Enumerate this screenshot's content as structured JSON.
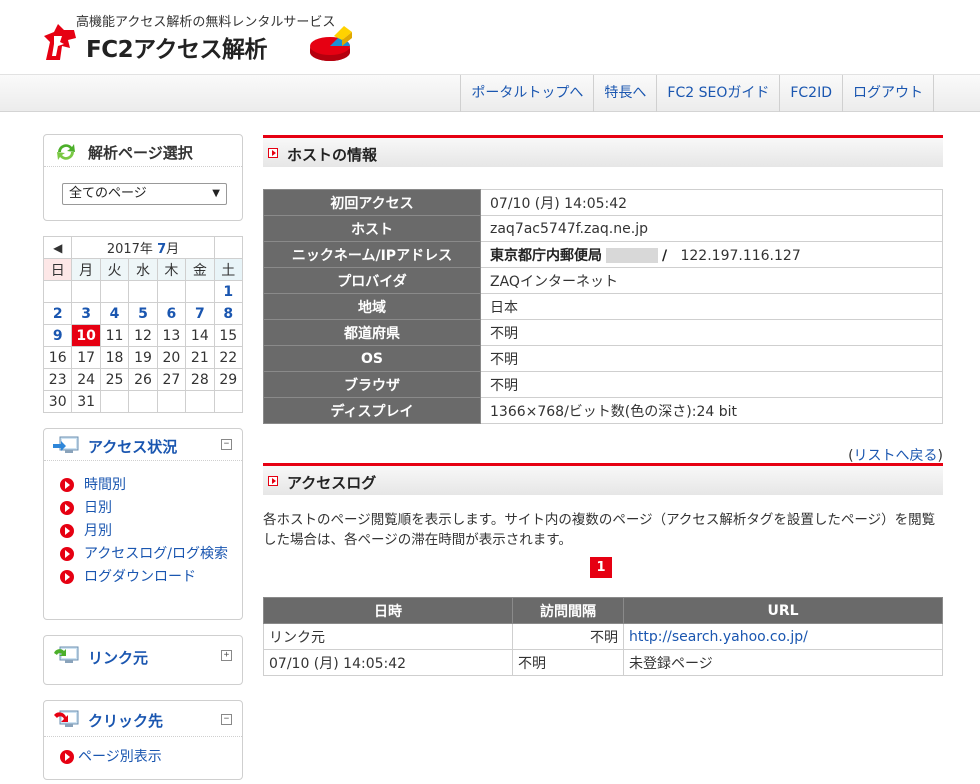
{
  "header": {
    "tagline": "高機能アクセス解析の無料レンタルサービス",
    "logo_text": "FC2アクセス解析"
  },
  "nav": [
    {
      "label": "ポータルトップへ"
    },
    {
      "label": "特長へ"
    },
    {
      "label": "FC2 SEOガイド"
    },
    {
      "label": "FC2ID"
    },
    {
      "label": "ログアウト"
    }
  ],
  "sidebar": {
    "page_select": {
      "title": "解析ページ選択",
      "selected": "全てのページ"
    },
    "calendar": {
      "prev": "◀",
      "year": "2017年",
      "month": "7",
      "month_suffix": "月",
      "weekdays": [
        "日",
        "月",
        "火",
        "水",
        "木",
        "金",
        "土"
      ],
      "weeks": [
        [
          "",
          "",
          "",
          "",
          "",
          "",
          "1"
        ],
        [
          "2",
          "3",
          "4",
          "5",
          "6",
          "7",
          "8"
        ],
        [
          "9",
          "10",
          "11",
          "12",
          "13",
          "14",
          "15"
        ],
        [
          "16",
          "17",
          "18",
          "19",
          "20",
          "21",
          "22"
        ],
        [
          "23",
          "24",
          "25",
          "26",
          "27",
          "28",
          "29"
        ],
        [
          "30",
          "31",
          "",
          "",
          "",
          "",
          ""
        ]
      ],
      "today": "10"
    },
    "access": {
      "title": "アクセス状況",
      "toggle": "−",
      "items": [
        {
          "label": "時間別"
        },
        {
          "label": "日別"
        },
        {
          "label": "月別"
        },
        {
          "label": "アクセスログ/ログ検索"
        },
        {
          "label": "ログダウンロード"
        }
      ]
    },
    "link": {
      "title": "リンク元",
      "toggle": "+"
    },
    "click": {
      "title": "クリック先",
      "toggle": "−",
      "items": [
        {
          "label": "ページ別表示"
        }
      ]
    }
  },
  "host": {
    "title": "ホストの情報",
    "rows": [
      {
        "label": "初回アクセス",
        "value": "07/10 (月) 14:05:42"
      },
      {
        "label": "ホスト",
        "value": "zaq7ac5747f.zaq.ne.jp"
      },
      {
        "label": "ニックネーム/IPアドレス",
        "nickname": "東京都庁内郵便局",
        "separator": "/",
        "ip": "122.197.116.127"
      },
      {
        "label": "プロバイダ",
        "value": "ZAQインターネット"
      },
      {
        "label": "地域",
        "value": "日本"
      },
      {
        "label": "都道府県",
        "value": "不明"
      },
      {
        "label": "OS",
        "value": "不明"
      },
      {
        "label": "ブラウザ",
        "value": "不明"
      },
      {
        "label": "ディスプレイ",
        "value": "1366×768/ビット数(色の深さ):24 bit"
      }
    ],
    "back_open": "(",
    "back_label": "リストへ戻る",
    "back_close": ")"
  },
  "log": {
    "title": "アクセスログ",
    "description": "各ホストのページ閲覧順を表示します。サイト内の複数のページ（アクセス解析タグを設置したページ）を閲覧した場合は、各ページの滞在時間が表示されます。",
    "page": "1",
    "columns": [
      "日時",
      "訪問間隔",
      "URL"
    ],
    "rows": [
      {
        "date": "リンク元",
        "interval": "不明",
        "url": "http://search.yahoo.co.jp/"
      },
      {
        "date": "07/10 (月) 14:05:42",
        "interval": "不明",
        "url": "未登録ページ"
      }
    ]
  },
  "colors": {
    "accent_red": "#e60012",
    "link_blue": "#1a56b0",
    "table_header": "#6a6a6a"
  }
}
